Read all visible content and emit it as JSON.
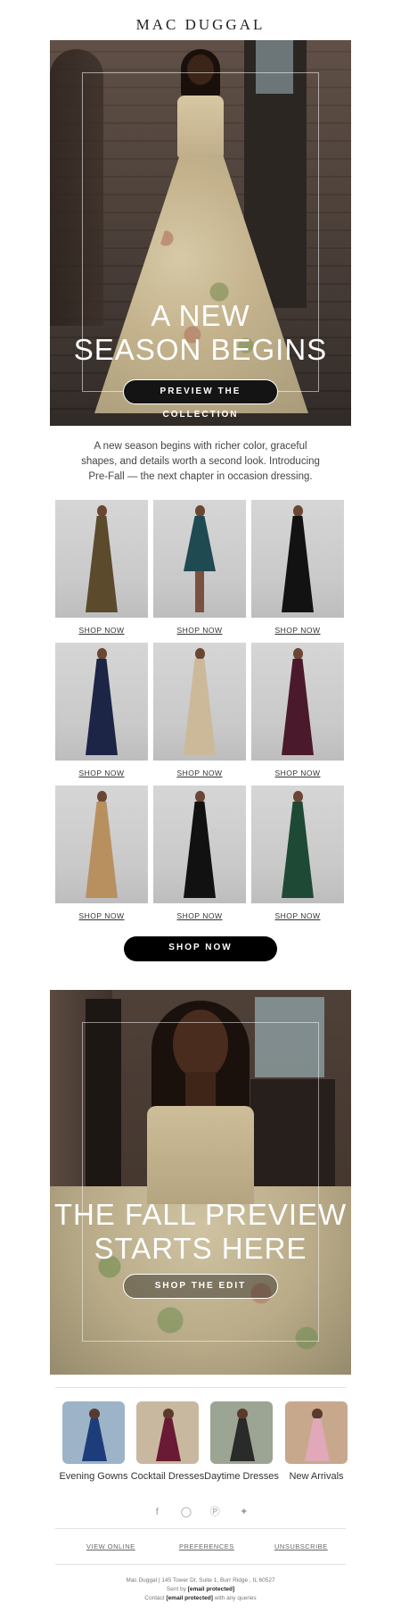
{
  "brand": "MAC DUGGAL",
  "hero": {
    "headline_line1": "A NEW",
    "headline_line2": "SEASON BEGINS",
    "cta": "PREVIEW THE COLLECTION"
  },
  "intro": "A new season begins with richer color, graceful shapes, and details worth a second look. Introducing Pre-Fall — the next chapter in occasion dressing.",
  "products": [
    {
      "link": "SHOP NOW",
      "dress_color": "#5b4a2c",
      "style": "gown"
    },
    {
      "link": "SHOP NOW",
      "dress_color": "#1f4a52",
      "style": "short"
    },
    {
      "link": "SHOP NOW",
      "dress_color": "#121212",
      "style": "gown"
    },
    {
      "link": "SHOP NOW",
      "dress_color": "#1c2545",
      "style": "gown"
    },
    {
      "link": "SHOP NOW",
      "dress_color": "#cbb99a",
      "style": "gown"
    },
    {
      "link": "SHOP NOW",
      "dress_color": "#4a1a2c",
      "style": "gown"
    },
    {
      "link": "SHOP NOW",
      "dress_color": "#b89060",
      "style": "gown"
    },
    {
      "link": "SHOP NOW",
      "dress_color": "#111111",
      "style": "gown"
    },
    {
      "link": "SHOP NOW",
      "dress_color": "#1e4a35",
      "style": "gown"
    }
  ],
  "shop_now_button": "SHOP NOW",
  "hero2": {
    "headline_line1": "THE FALL PREVIEW",
    "headline_line2": "STARTS HERE",
    "cta": "SHOP THE EDIT"
  },
  "categories": [
    {
      "label": "Evening Gowns",
      "bg": "#9db4c8",
      "dress": "#1d3d7a"
    },
    {
      "label": "Cocktail Dresses",
      "bg": "#c9b8a0",
      "dress": "#6a1a35"
    },
    {
      "label": "Daytime Dresses",
      "bg": "#9ca593",
      "dress": "#2a2a2a"
    },
    {
      "label": "New Arrivals",
      "bg": "#c7a88d",
      "dress": "#e0a8b8"
    }
  ],
  "social": [
    "facebook-icon",
    "instagram-icon",
    "pinterest-icon",
    "twitter-icon"
  ],
  "footer_links": {
    "view_online": "VIEW ONLINE",
    "preferences": "PREFERENCES",
    "unsubscribe": "UNSUBSCRIBE"
  },
  "footer": {
    "address": "Mac Duggal | 145 Tower Dr, Suite 1, Burr Ridge , IL 60527",
    "sent_by_prefix": "Sent by",
    "sent_by_email": "[email protected]",
    "contact_prefix": "Contact",
    "contact_email": "[email protected]",
    "contact_suffix": "with any queries"
  }
}
